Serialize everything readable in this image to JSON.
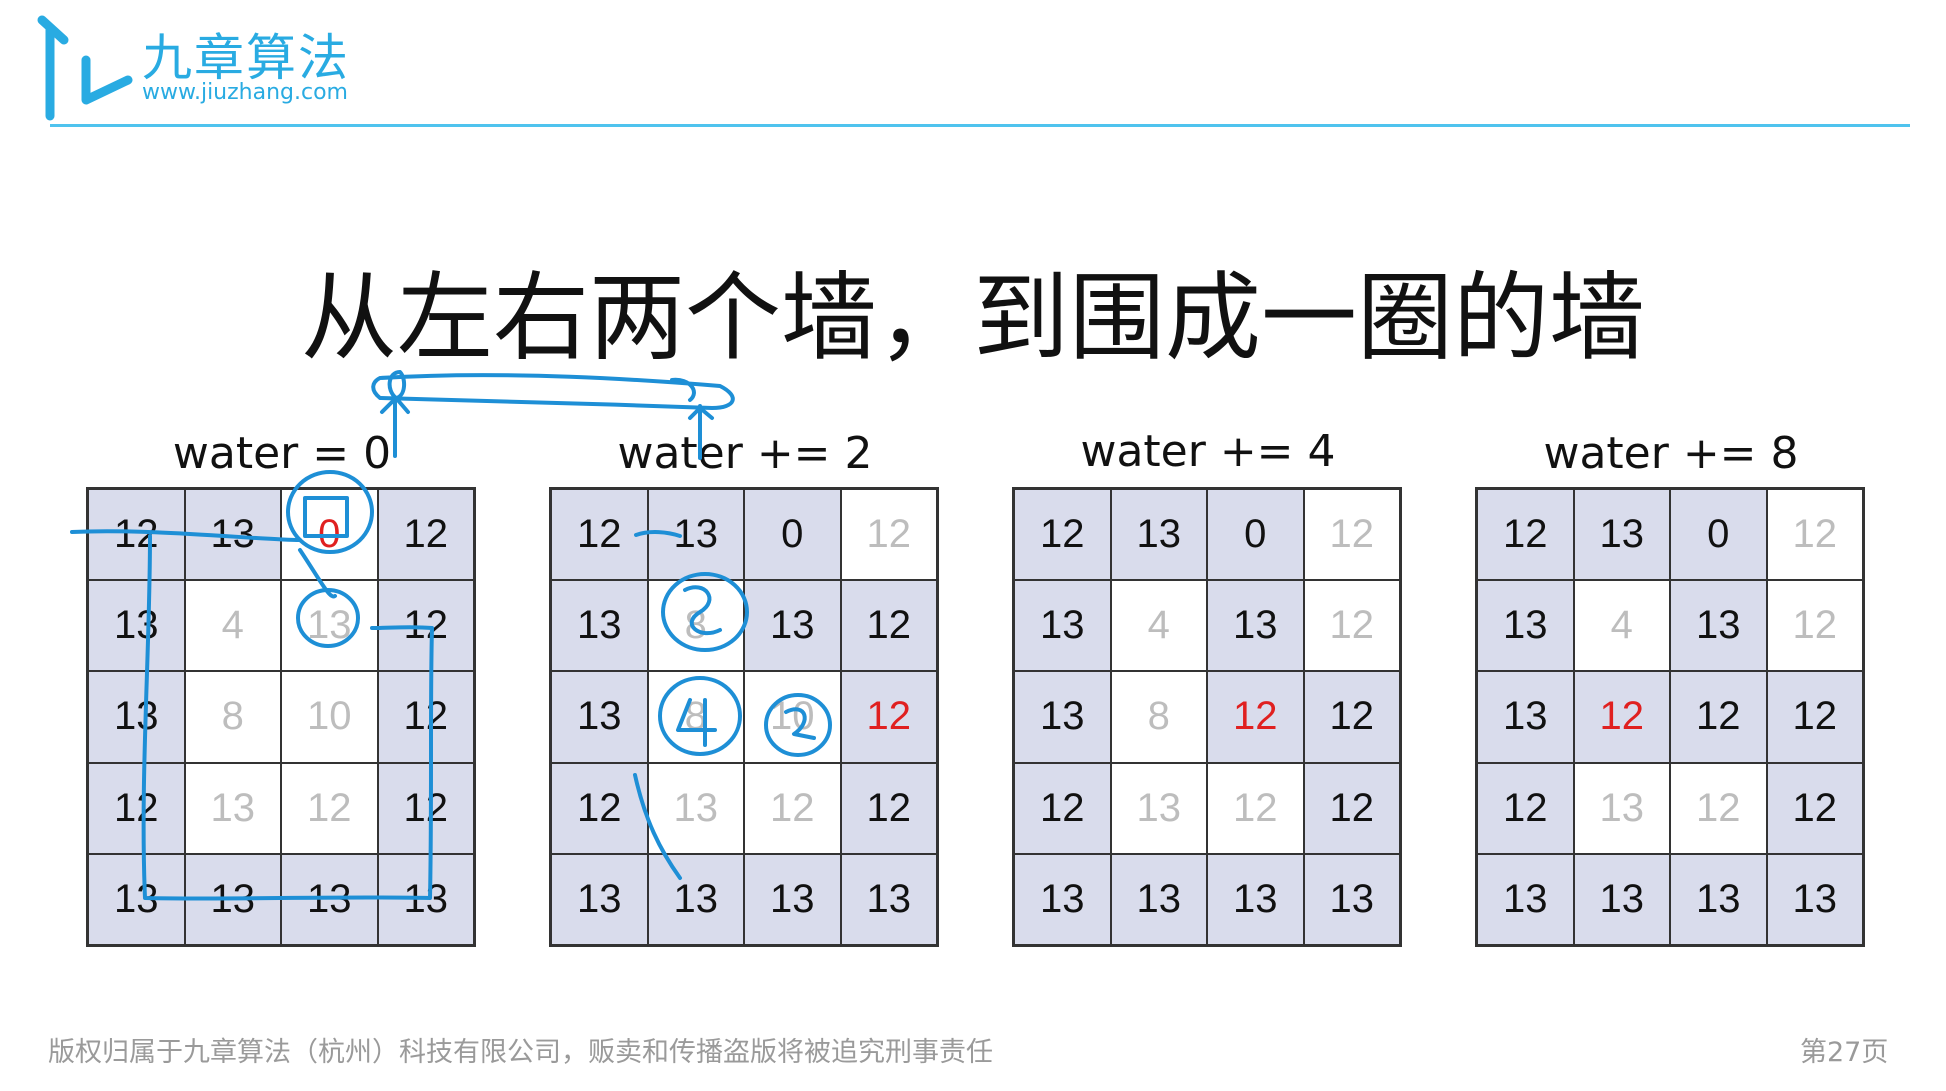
{
  "brand": {
    "name": "九章算法",
    "url": "www.jiuzhang.com",
    "accent_color": "#29abe2"
  },
  "title": "从左右两个墙，到围成一圈的墙",
  "panels": [
    {
      "label": "water = 0",
      "rows": [
        [
          "12",
          "13",
          "0",
          "12"
        ],
        [
          "13",
          "4",
          "13",
          "12"
        ],
        [
          "13",
          "8",
          "10",
          "12"
        ],
        [
          "12",
          "13",
          "12",
          "12"
        ],
        [
          "13",
          "13",
          "13",
          "13"
        ]
      ],
      "walls": [
        [
          1,
          1,
          0,
          1
        ],
        [
          1,
          0,
          0,
          1
        ],
        [
          1,
          0,
          0,
          1
        ],
        [
          1,
          0,
          0,
          1
        ],
        [
          1,
          1,
          1,
          1
        ]
      ],
      "highlight": [
        [
          0,
          2
        ]
      ]
    },
    {
      "label": "water += 2",
      "rows": [
        [
          "12",
          "13",
          "0",
          "12"
        ],
        [
          "13",
          "8",
          "13",
          "12"
        ],
        [
          "13",
          "8",
          "10",
          "12"
        ],
        [
          "12",
          "13",
          "12",
          "12"
        ],
        [
          "13",
          "13",
          "13",
          "13"
        ]
      ],
      "walls": [
        [
          1,
          1,
          1,
          0
        ],
        [
          1,
          0,
          1,
          1
        ],
        [
          1,
          0,
          0,
          1
        ],
        [
          1,
          0,
          0,
          1
        ],
        [
          1,
          1,
          1,
          1
        ]
      ],
      "highlight": [
        [
          2,
          3
        ]
      ]
    },
    {
      "label": "water += 4",
      "rows": [
        [
          "12",
          "13",
          "0",
          "12"
        ],
        [
          "13",
          "4",
          "13",
          "12"
        ],
        [
          "13",
          "8",
          "12",
          "12"
        ],
        [
          "12",
          "13",
          "12",
          "12"
        ],
        [
          "13",
          "13",
          "13",
          "13"
        ]
      ],
      "walls": [
        [
          1,
          1,
          1,
          0
        ],
        [
          1,
          0,
          1,
          0
        ],
        [
          1,
          0,
          1,
          1
        ],
        [
          1,
          0,
          0,
          1
        ],
        [
          1,
          1,
          1,
          1
        ]
      ],
      "highlight": [
        [
          2,
          2
        ]
      ]
    },
    {
      "label": "water += 8",
      "rows": [
        [
          "12",
          "13",
          "0",
          "12"
        ],
        [
          "13",
          "4",
          "13",
          "12"
        ],
        [
          "13",
          "12",
          "12",
          "12"
        ],
        [
          "12",
          "13",
          "12",
          "12"
        ],
        [
          "13",
          "13",
          "13",
          "13"
        ]
      ],
      "walls": [
        [
          1,
          1,
          1,
          0
        ],
        [
          1,
          0,
          1,
          0
        ],
        [
          1,
          1,
          1,
          1
        ],
        [
          1,
          0,
          0,
          1
        ],
        [
          1,
          1,
          1,
          1
        ]
      ],
      "highlight": [
        [
          2,
          1
        ]
      ]
    }
  ],
  "footer": {
    "copyright": "版权归属于九章算法（杭州）科技有限公司，贩卖和传播盗版将被追究刑事责任",
    "page": "第27页"
  }
}
